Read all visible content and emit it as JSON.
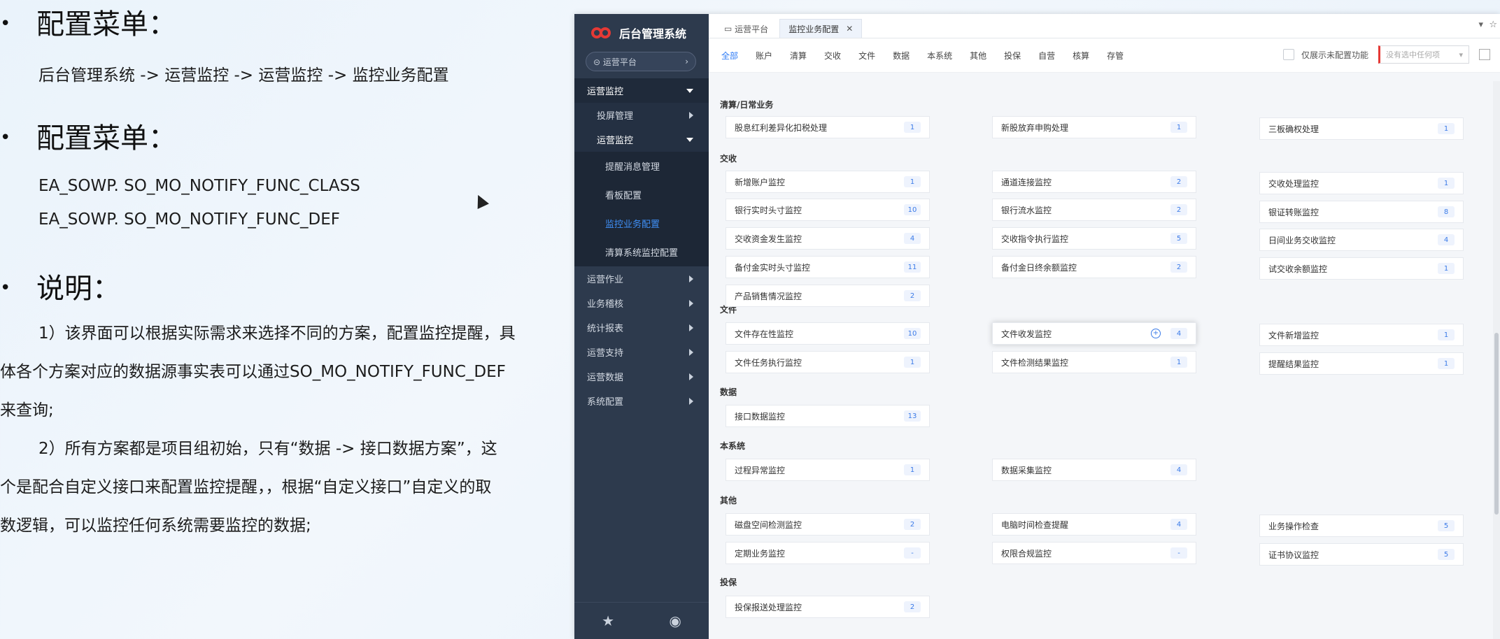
{
  "slide": {
    "h1": "配置菜单：",
    "path": "后台管理系统 -> 运营监控 -> 运营监控 -> 监控业务配置",
    "h2": "配置菜单：",
    "table1": "EA_SOWP. SO_MO_NOTIFY_FUNC_CLASS",
    "table2": "EA_SOWP. SO_MO_NOTIFY_FUNC_DEF",
    "h3": "说明：",
    "p1_line1": "1）该界面可以根据实际需求来选择不同的方案，配置监控提醒，具",
    "p1_line2": "体各个方案对应的数据源事实表可以通过SO_MO_NOTIFY_FUNC_DEF",
    "p1_line3": "来查询;",
    "p2_line1": "2）所有方案都是项目组初始，只有“数据 -> 接口数据方案”，这",
    "p2_line2": "个是配合自定义接口来配置监控提醒，，根据“自定义接口”自定义的取",
    "p2_line3": "数逻辑，可以监控任何系统需要监控的数据;"
  },
  "app": {
    "title": "后台管理系统",
    "platform": "运营平台",
    "menu": {
      "ops_monitor": "运营监控",
      "screen_mgmt": "投屏管理",
      "ops_monitor_sub": "运营监控",
      "leaf_reminder": "提醒消息管理",
      "leaf_board": "看板配置",
      "leaf_config": "监控业务配置",
      "leaf_clearing": "清算系统监控配置",
      "ops_work": "运营作业",
      "biz_check": "业务稽核",
      "stats": "统计报表",
      "ops_support": "运营支持",
      "ops_data": "运营数据",
      "sys_config": "系统配置"
    },
    "tabs": {
      "tab1": "运营平台",
      "tab2": "监控业务配置"
    },
    "filters": [
      "全部",
      "账户",
      "清算",
      "交收",
      "文件",
      "数据",
      "本系统",
      "其他",
      "投保",
      "自营",
      "核算",
      "存管"
    ],
    "only_unconfigured": "仅展示未配置功能",
    "select_placeholder": "没有选中任何项",
    "sections": {
      "s1": "清算/日常业务",
      "s2": "交收",
      "s3": "文件",
      "s4": "数据",
      "s5": "本系统",
      "s6": "其他",
      "s7": "投保"
    },
    "cards": {
      "c1": {
        "label": "股息红利差异化扣税处理",
        "count": "1"
      },
      "c2": {
        "label": "新股放弃申购处理",
        "count": "1"
      },
      "c3": {
        "label": "三板确权处理",
        "count": "1"
      },
      "c4": {
        "label": "新增账户监控",
        "count": "1"
      },
      "c5": {
        "label": "通道连接监控",
        "count": "2"
      },
      "c6": {
        "label": "交收处理监控",
        "count": "1"
      },
      "c7": {
        "label": "银行实时头寸监控",
        "count": "10"
      },
      "c8": {
        "label": "银行流水监控",
        "count": "2"
      },
      "c9": {
        "label": "银证转账监控",
        "count": "8"
      },
      "c10": {
        "label": "交收资金发生监控",
        "count": "4"
      },
      "c11": {
        "label": "交收指令执行监控",
        "count": "5"
      },
      "c12": {
        "label": "日间业务交收监控",
        "count": "4"
      },
      "c13": {
        "label": "备付金实时头寸监控",
        "count": "11"
      },
      "c14": {
        "label": "备付金日终余额监控",
        "count": "2"
      },
      "c15": {
        "label": "试交收余额监控",
        "count": "1"
      },
      "c16": {
        "label": "产品销售情况监控",
        "count": "2"
      },
      "c17": {
        "label": "文件存在性监控",
        "count": "10"
      },
      "c18": {
        "label": "文件收发监控",
        "count": "4"
      },
      "c19": {
        "label": "文件新增监控",
        "count": "1"
      },
      "c20": {
        "label": "文件任务执行监控",
        "count": "1"
      },
      "c21": {
        "label": "文件检测结果监控",
        "count": "1"
      },
      "c22": {
        "label": "提醒结果监控",
        "count": "1"
      },
      "c23": {
        "label": "接口数据监控",
        "count": "13"
      },
      "c24": {
        "label": "过程异常监控",
        "count": "1"
      },
      "c25": {
        "label": "数据采集监控",
        "count": "4"
      },
      "c26": {
        "label": "磁盘空间检测监控",
        "count": "2"
      },
      "c27": {
        "label": "电脑时间检查提醒",
        "count": "4"
      },
      "c28": {
        "label": "业务操作检查",
        "count": "5"
      },
      "c29": {
        "label": "定期业务监控",
        "count": "-"
      },
      "c30": {
        "label": "权限合规监控",
        "count": "-"
      },
      "c31": {
        "label": "证书协议监控",
        "count": "5"
      },
      "c32": {
        "label": "投保报送处理监控",
        "count": "2"
      }
    }
  }
}
